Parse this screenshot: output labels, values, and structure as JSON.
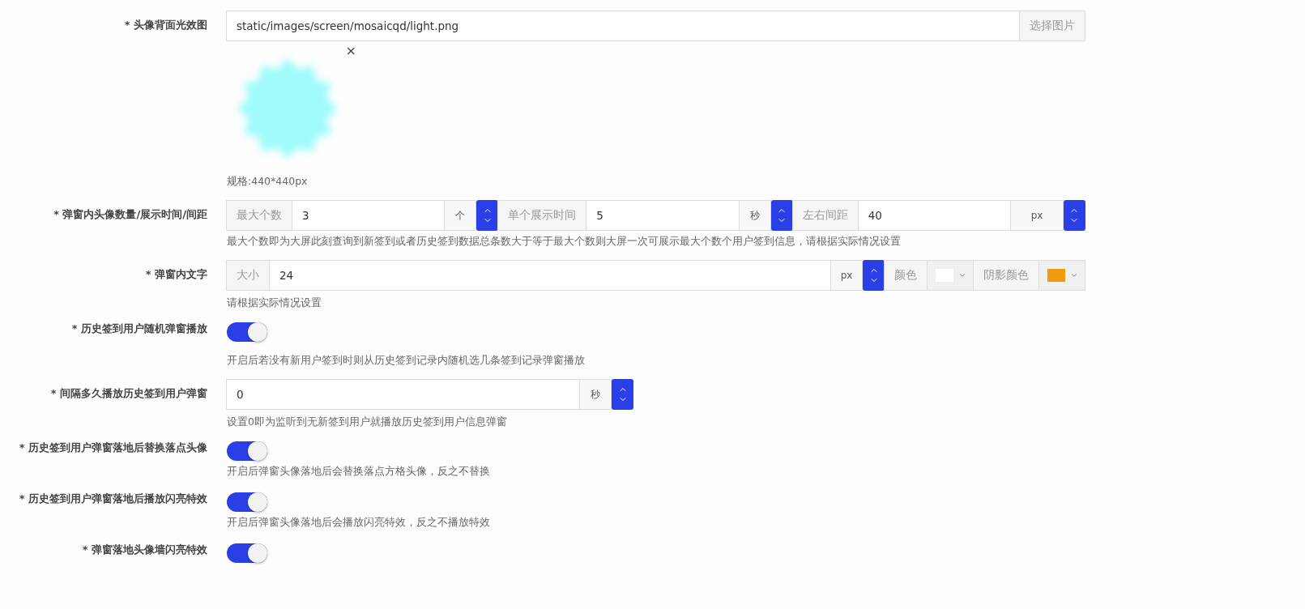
{
  "rows": [
    {
      "kind": "image",
      "label": "* 头像背面光效图",
      "value": "static/images/screen/mosaicqd/light.png",
      "button": "选择图片",
      "remove": "×",
      "hint": "规格:440*440px"
    },
    {
      "kind": "number_group",
      "label": "* 弹窗内头像数量/展示时间/间距",
      "fields": [
        {
          "prefix": "最大个数",
          "value": "3",
          "unit": "个"
        },
        {
          "prefix": "单个展示时间",
          "value": "5",
          "unit": "秒"
        },
        {
          "prefix": "左右间距",
          "value": "40",
          "unit": "px"
        }
      ],
      "hint": "最大个数即为大屏此刻查询到新签到或者历史签到数据总条数大于等于最大个数则大屏一次可展示最大个数个用户签到信息，请根据实际情况设置"
    },
    {
      "kind": "text_style",
      "label": "* 弹窗内文字",
      "fields": [
        {
          "prefix": "大小",
          "value": "24",
          "unit": "px"
        }
      ],
      "colors": [
        {
          "label": "颜色",
          "color": "#ffffff"
        },
        {
          "label": "阴影颜色",
          "color": "#f09a0f"
        }
      ],
      "hint": "请根据实际情况设置"
    },
    {
      "kind": "switch",
      "label": "* 历史签到用户随机弹窗播放",
      "on": true,
      "hint": "开启后若没有新用户签到时则从历史签到记录内随机选几条签到记录弹窗播放"
    },
    {
      "kind": "number",
      "label": "* 间隔多久播放历史签到用户弹窗",
      "fields": [
        {
          "value": "0",
          "unit": "秒"
        }
      ],
      "hint": "设置0即为监听到无新签到用户就播放历史签到用户信息弹窗"
    },
    {
      "kind": "switch",
      "label": "* 历史签到用户弹窗落地后替换落点头像",
      "on": true,
      "hint": "开启后弹窗头像落地后会替换落点方格头像，反之不替换"
    },
    {
      "kind": "switch",
      "label": "* 历史签到用户弹窗落地后播放闪亮特效",
      "on": true,
      "hint": "开启后弹窗头像落地后会播放闪亮特效，反之不播放特效"
    },
    {
      "kind": "switch",
      "label": "* 弹窗落地头像墙闪亮特效",
      "on": true
    }
  ]
}
